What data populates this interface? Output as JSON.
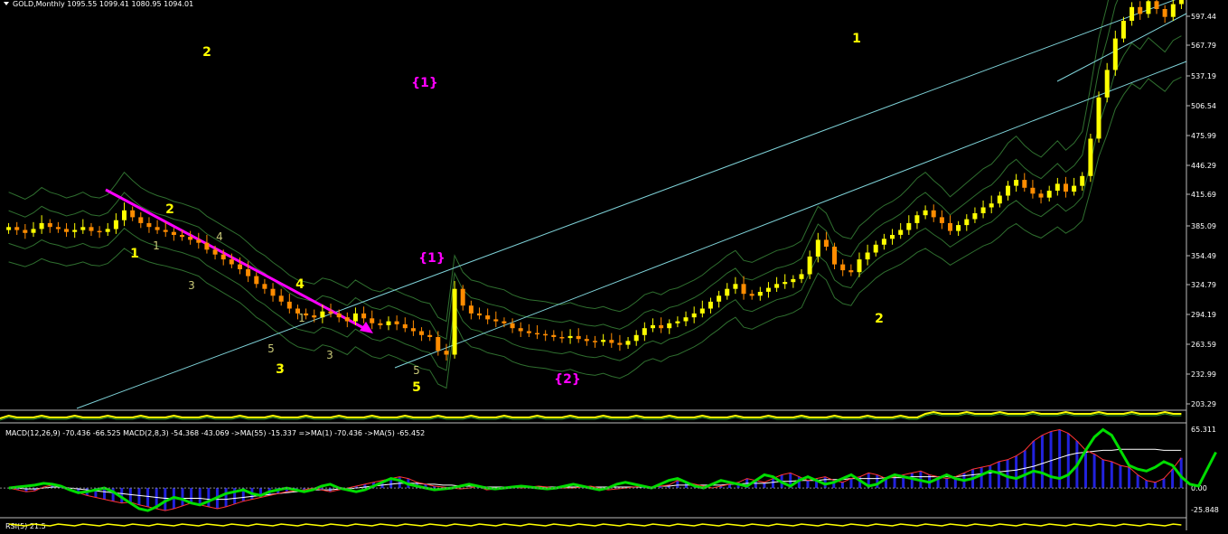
{
  "symbol_header": "GOLD,Monthly  1095.55 1099.41 1080.95 1094.01",
  "colors": {
    "background": "#000000",
    "bull_candle": "#ffff00",
    "bear_candle": "#ff8c00",
    "channel": "#7fd3d9",
    "envelope": "#2f6f2f",
    "wave_label": "#ffff00",
    "wave_label_minor": "#c8c878",
    "wave_label_major": "#ff00ff",
    "macd_hist": "#2222dd",
    "macd_signal": "#00dd00",
    "axis_text": "#ffffff"
  },
  "chart_data": [
    {
      "type": "candlestick",
      "title": "GOLD,Monthly",
      "ohlc_last": {
        "open": 1095.55,
        "high": 1099.41,
        "low": 1080.95,
        "close": 1094.01
      },
      "y_ticks": [
        "597.44",
        "567.79",
        "537.19",
        "506.54",
        "475.99",
        "446.29",
        "415.69",
        "385.09",
        "354.49",
        "324.79",
        "294.19",
        "263.59",
        "232.99",
        "203.29"
      ],
      "ylim": [
        203.29,
        610
      ],
      "close": [
        388,
        385,
        382,
        386,
        392,
        388,
        386,
        383,
        385,
        388,
        384,
        383,
        386,
        395,
        405,
        398,
        392,
        388,
        385,
        383,
        380,
        378,
        375,
        372,
        365,
        360,
        355,
        350,
        345,
        338,
        330,
        325,
        318,
        312,
        305,
        300,
        298,
        296,
        302,
        300,
        296,
        292,
        300,
        295,
        290,
        288,
        292,
        289,
        285,
        282,
        278,
        276,
        262,
        258,
        325,
        308,
        300,
        298,
        294,
        292,
        290,
        285,
        282,
        280,
        279,
        278,
        276,
        275,
        277,
        274,
        272,
        271,
        273,
        270,
        268,
        272,
        278,
        285,
        288,
        285,
        290,
        292,
        296,
        300,
        305,
        312,
        318,
        325,
        330,
        320,
        318,
        322,
        326,
        330,
        332,
        335,
        340,
        358,
        375,
        368,
        350,
        344,
        342,
        355,
        362,
        370,
        376,
        380,
        385,
        392,
        400,
        405,
        398,
        392,
        384,
        390,
        396,
        402,
        408,
        412,
        420,
        430,
        436,
        428,
        422,
        418,
        425,
        432,
        424,
        430,
        440,
        478,
        520,
        548,
        580,
        598,
        612,
        605,
        618,
        610,
        602,
        615,
        620
      ],
      "open": [
        385,
        388,
        385,
        382,
        386,
        392,
        388,
        386,
        383,
        385,
        388,
        384,
        383,
        386,
        395,
        405,
        398,
        392,
        388,
        385,
        383,
        380,
        378,
        375,
        372,
        365,
        360,
        355,
        350,
        345,
        338,
        330,
        325,
        318,
        312,
        305,
        300,
        298,
        296,
        302,
        300,
        296,
        292,
        300,
        295,
        290,
        288,
        292,
        289,
        285,
        282,
        278,
        276,
        262,
        258,
        325,
        308,
        300,
        298,
        294,
        292,
        290,
        285,
        282,
        280,
        279,
        278,
        276,
        275,
        277,
        274,
        272,
        271,
        273,
        270,
        268,
        272,
        278,
        285,
        288,
        285,
        290,
        292,
        296,
        300,
        305,
        312,
        318,
        325,
        330,
        320,
        318,
        322,
        326,
        330,
        332,
        335,
        340,
        358,
        375,
        368,
        350,
        344,
        342,
        355,
        362,
        370,
        376,
        380,
        385,
        392,
        400,
        405,
        398,
        392,
        384,
        390,
        396,
        402,
        408,
        412,
        420,
        430,
        436,
        428,
        422,
        418,
        425,
        432,
        424,
        430,
        440,
        478,
        520,
        548,
        580,
        598,
        612,
        605,
        618,
        610,
        602,
        615
      ]
    },
    {
      "type": "line",
      "title": "MACD(12,26,9) -70.436 -66.525  MACD(2,8,3) -54.368 -43.069  ->MA(55) -15.337  =>MA(1) -70.436  ->MA(5) -65.452",
      "y_ticks": [
        "65.311",
        "0.00",
        "-25.848"
      ],
      "ylim": [
        -25.848,
        65.311
      ],
      "macd_fast": [
        0,
        -2,
        -4,
        -3,
        1,
        3,
        2,
        -1,
        -5,
        -8,
        -10,
        -12,
        -14,
        -16,
        -15,
        -18,
        -20,
        -22,
        -24,
        -22,
        -19,
        -16,
        -18,
        -20,
        -22,
        -20,
        -17,
        -14,
        -12,
        -10,
        -8,
        -6,
        -4,
        -3,
        -2,
        0,
        -2,
        -4,
        -2,
        0,
        2,
        4,
        6,
        8,
        10,
        12,
        10,
        6,
        4,
        2,
        1,
        0,
        -1,
        0,
        2,
        -2,
        -1,
        0,
        1,
        0,
        1,
        2,
        1,
        0,
        0,
        0,
        1,
        2,
        0,
        -2,
        -1,
        0,
        1,
        2,
        1,
        2,
        3,
        8,
        6,
        4,
        2,
        0,
        2,
        4,
        6,
        10,
        8,
        6,
        10,
        14,
        16,
        12,
        8,
        10,
        12,
        8,
        6,
        10,
        12,
        16,
        14,
        10,
        12,
        14,
        16,
        18,
        14,
        12,
        10,
        12,
        16,
        20,
        22,
        24,
        28,
        30,
        34,
        40,
        50,
        56,
        60,
        62,
        58,
        50,
        40,
        36,
        30,
        28,
        24,
        22,
        14,
        8,
        6,
        10,
        20,
        32
      ],
      "ma_line": [
        0,
        0,
        -1,
        -1,
        0,
        1,
        1,
        0,
        -1,
        -2,
        -3,
        -4,
        -5,
        -6,
        -7,
        -8,
        -9,
        -10,
        -11,
        -11,
        -11,
        -11,
        -11,
        -12,
        -12,
        -12,
        -11,
        -10,
        -9,
        -8,
        -7,
        -6,
        -5,
        -4,
        -3,
        -2,
        -2,
        -2,
        -1,
        -1,
        0,
        1,
        2,
        3,
        4,
        5,
        5,
        5,
        4,
        4,
        3,
        3,
        2,
        2,
        2,
        1,
        1,
        1,
        1,
        1,
        1,
        1,
        1,
        1,
        1,
        1,
        1,
        1,
        1,
        1,
        1,
        1,
        1,
        1,
        1,
        2,
        2,
        3,
        3,
        3,
        3,
        3,
        3,
        4,
        4,
        5,
        5,
        5,
        6,
        7,
        7,
        8,
        8,
        8,
        9,
        9,
        9,
        10,
        10,
        10,
        10,
        11,
        11,
        11,
        12,
        12,
        12,
        12,
        12,
        12,
        13,
        14,
        15,
        16,
        17,
        18,
        19,
        21,
        23,
        26,
        29,
        32,
        35,
        37,
        38,
        39,
        40,
        40,
        41,
        41,
        41,
        41,
        41,
        40,
        40,
        40
      ],
      "macd_signal": [
        0,
        1,
        2,
        3,
        5,
        4,
        2,
        -2,
        -5,
        -4,
        -2,
        0,
        -4,
        -10,
        -16,
        -22,
        -24,
        -20,
        -14,
        -10,
        -12,
        -16,
        -18,
        -14,
        -10,
        -6,
        -4,
        -2,
        -6,
        -8,
        -4,
        -2,
        0,
        -2,
        -4,
        -2,
        2,
        4,
        0,
        -2,
        -4,
        -2,
        2,
        6,
        10,
        8,
        4,
        2,
        0,
        -2,
        -1,
        0,
        2,
        4,
        2,
        0,
        -1,
        0,
        1,
        2,
        1,
        0,
        -1,
        0,
        2,
        4,
        2,
        0,
        -2,
        0,
        4,
        6,
        4,
        2,
        0,
        4,
        8,
        10,
        6,
        2,
        0,
        4,
        8,
        6,
        4,
        2,
        8,
        14,
        12,
        6,
        2,
        8,
        12,
        8,
        4,
        6,
        10,
        14,
        8,
        2,
        4,
        10,
        14,
        12,
        10,
        8,
        6,
        10,
        14,
        10,
        8,
        10,
        14,
        18,
        16,
        12,
        10,
        14,
        18,
        16,
        12,
        10,
        14,
        24,
        40,
        54,
        62,
        56,
        40,
        24,
        20,
        18,
        22,
        28,
        24,
        12,
        4,
        2,
        20,
        38
      ]
    }
  ],
  "wave_labels": [
    {
      "text": "2",
      "color": "yellow"
    },
    {
      "text": "{1}",
      "color": "magenta"
    },
    {
      "text": "1",
      "color": "yellow"
    },
    {
      "text": "2",
      "color": "yellow"
    },
    {
      "text": "1",
      "color": "yellow"
    },
    {
      "text": "1",
      "color": "minor"
    },
    {
      "text": "4",
      "color": "minor"
    },
    {
      "text": "3",
      "color": "minor"
    },
    {
      "text": "4",
      "color": "yellow"
    },
    {
      "text": "1",
      "color": "minor"
    },
    {
      "text": "5",
      "color": "minor"
    },
    {
      "text": "3",
      "color": "minor"
    },
    {
      "text": "3",
      "color": "yellow"
    },
    {
      "text": "{1}",
      "color": "magenta"
    },
    {
      "text": "5",
      "color": "minor"
    },
    {
      "text": "5",
      "color": "yellow"
    },
    {
      "text": "{2}",
      "color": "magenta"
    },
    {
      "text": "2",
      "color": "yellow"
    }
  ],
  "rsi_header": "RSI(5) 21.5"
}
